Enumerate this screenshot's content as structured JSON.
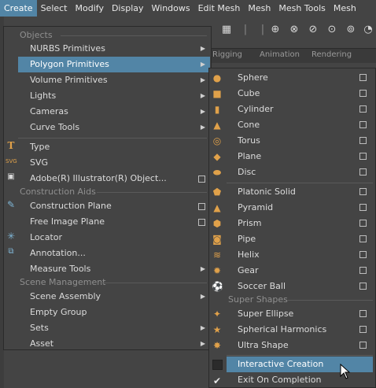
{
  "menubar": {
    "items": [
      "Create",
      "Select",
      "Modify",
      "Display",
      "Windows",
      "Edit Mesh",
      "Mesh",
      "Mesh Tools",
      "Mesh"
    ]
  },
  "background_tabs": [
    "Rigging",
    "Animation",
    "Rendering"
  ],
  "create_menu": {
    "sections": {
      "objects": "Objects",
      "construction_aids": "Construction Aids",
      "scene_management": "Scene Management"
    },
    "items": {
      "nurbs": "NURBS Primitives",
      "polygon": "Polygon Primitives",
      "volume": "Volume Primitives",
      "lights": "Lights",
      "cameras": "Cameras",
      "curve_tools": "Curve Tools",
      "type": "Type",
      "svg": "SVG",
      "illustrator": "Adobe(R) Illustrator(R) Object...",
      "construction_plane": "Construction Plane",
      "free_image_plane": "Free Image Plane",
      "locator": "Locator",
      "annotation": "Annotation...",
      "measure_tools": "Measure Tools",
      "scene_assembly": "Scene Assembly",
      "empty_group": "Empty Group",
      "sets": "Sets",
      "asset": "Asset"
    }
  },
  "poly_menu": {
    "items": [
      "Sphere",
      "Cube",
      "Cylinder",
      "Cone",
      "Torus",
      "Plane",
      "Disc",
      "Platonic Solid",
      "Pyramid",
      "Prism",
      "Pipe",
      "Helix",
      "Gear",
      "Soccer Ball"
    ],
    "super_shapes_header": "Super Shapes",
    "super_shapes": [
      "Super Ellipse",
      "Spherical Harmonics",
      "Ultra Shape"
    ],
    "interactive_creation": "Interactive Creation",
    "exit_on_completion": "Exit On Completion"
  },
  "colors": {
    "highlight": "#5285a6",
    "menu_bg": "#444444",
    "icon_orange": "#e0a14a"
  }
}
